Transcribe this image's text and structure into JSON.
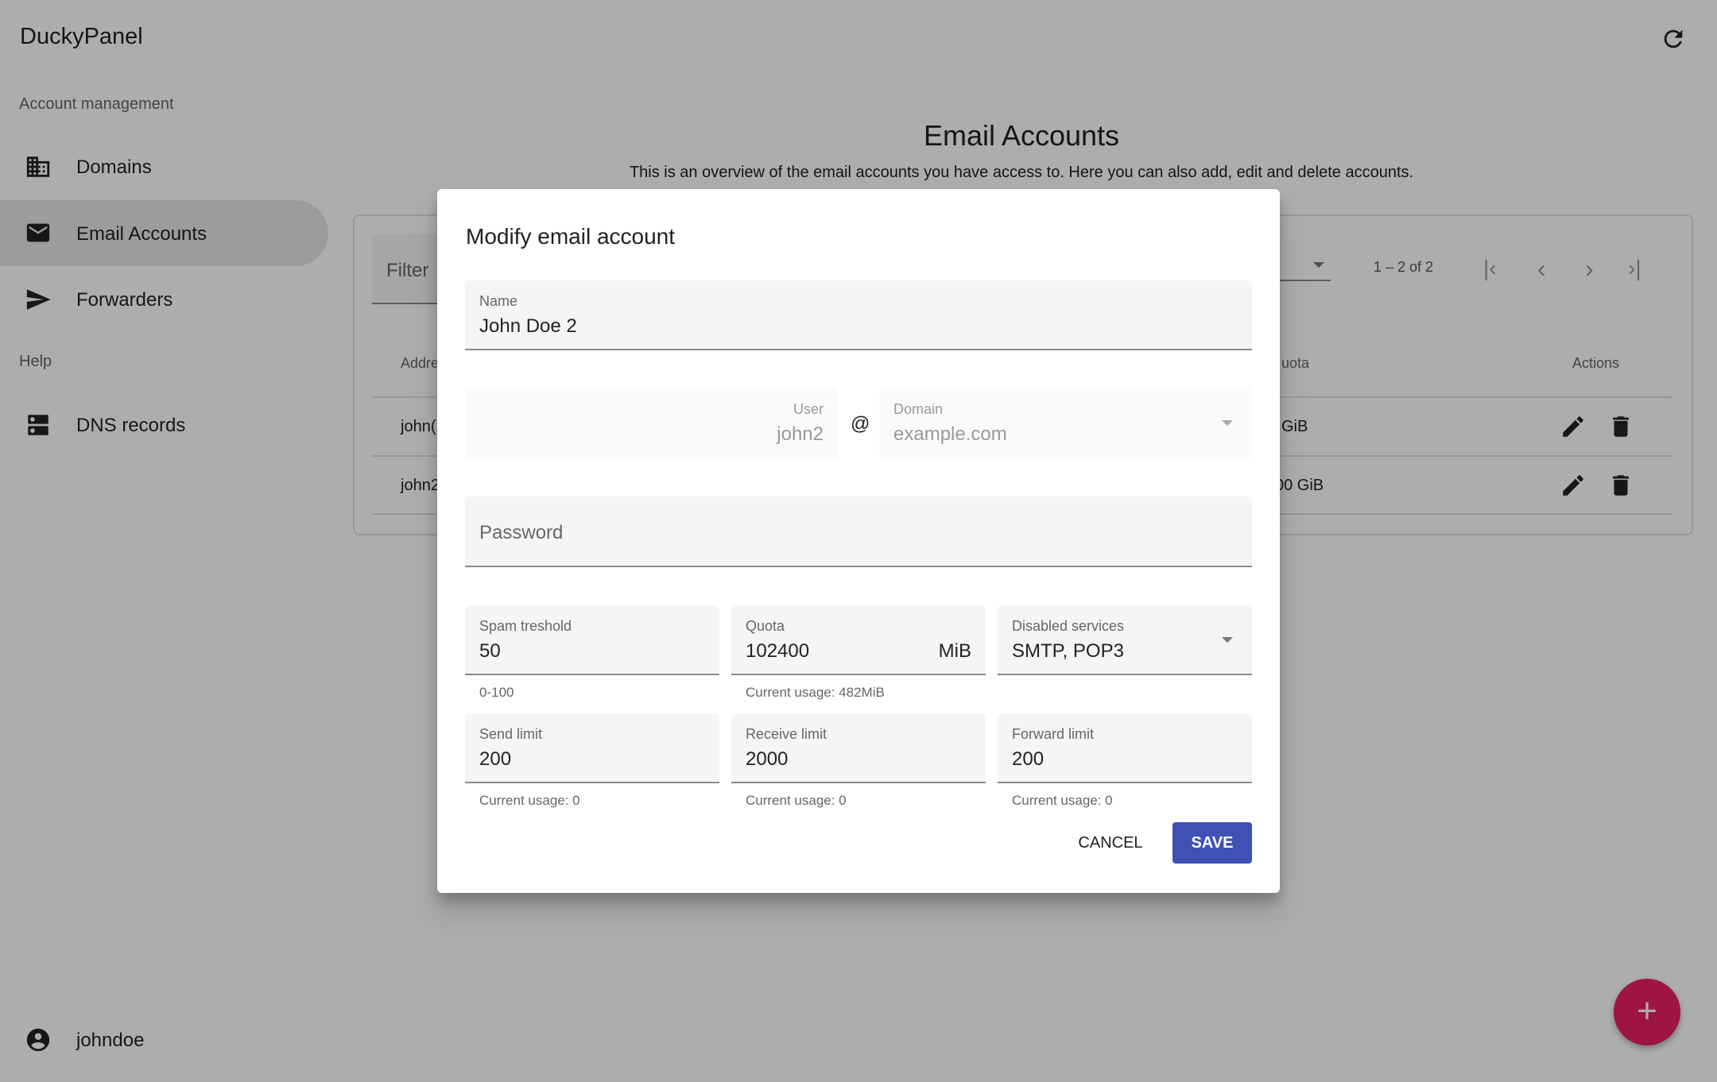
{
  "app": {
    "title": "DuckyPanel"
  },
  "sidebar": {
    "section_account": "Account management",
    "items": [
      {
        "label": "Domains",
        "icon": "domain-icon"
      },
      {
        "label": "Email Accounts",
        "icon": "email-icon",
        "active": true
      },
      {
        "label": "Forwarders",
        "icon": "send-icon"
      }
    ],
    "section_help": "Help",
    "help_items": [
      {
        "label": "DNS records",
        "icon": "dns-icon"
      }
    ],
    "user": "johndoe"
  },
  "page": {
    "title": "Email Accounts",
    "subtitle": "This is an overview of the email accounts you have access to. Here you can also add, edit and delete accounts."
  },
  "table": {
    "filter_placeholder": "Filter",
    "range": "1 – 2 of 2",
    "headers": {
      "address": "Addre",
      "quota": "uota",
      "actions": "Actions"
    },
    "rows": [
      {
        "address": "john(",
        "quota": "GiB"
      },
      {
        "address": "john2",
        "quota": "00 GiB"
      }
    ]
  },
  "dialog": {
    "title": "Modify email account",
    "name": {
      "label": "Name",
      "value": "John Doe 2"
    },
    "user": {
      "label": "User",
      "value": "john2"
    },
    "at": "@",
    "domain": {
      "label": "Domain",
      "value": "example.com"
    },
    "password": {
      "label": "Password"
    },
    "spam": {
      "label": "Spam treshold",
      "value": "50",
      "hint": "0-100"
    },
    "quota": {
      "label": "Quota",
      "value": "102400",
      "suffix": "MiB",
      "hint": "Current usage: 482MiB"
    },
    "disabled": {
      "label": "Disabled services",
      "value": "SMTP, POP3"
    },
    "send": {
      "label": "Send limit",
      "value": "200",
      "hint": "Current usage: 0"
    },
    "receive": {
      "label": "Receive limit",
      "value": "2000",
      "hint": "Current usage: 0"
    },
    "forward": {
      "label": "Forward limit",
      "value": "200",
      "hint": "Current usage: 0"
    },
    "cancel": "CANCEL",
    "save": "SAVE"
  },
  "colors": {
    "primary": "#3f51b5",
    "accent": "#e91e63"
  }
}
